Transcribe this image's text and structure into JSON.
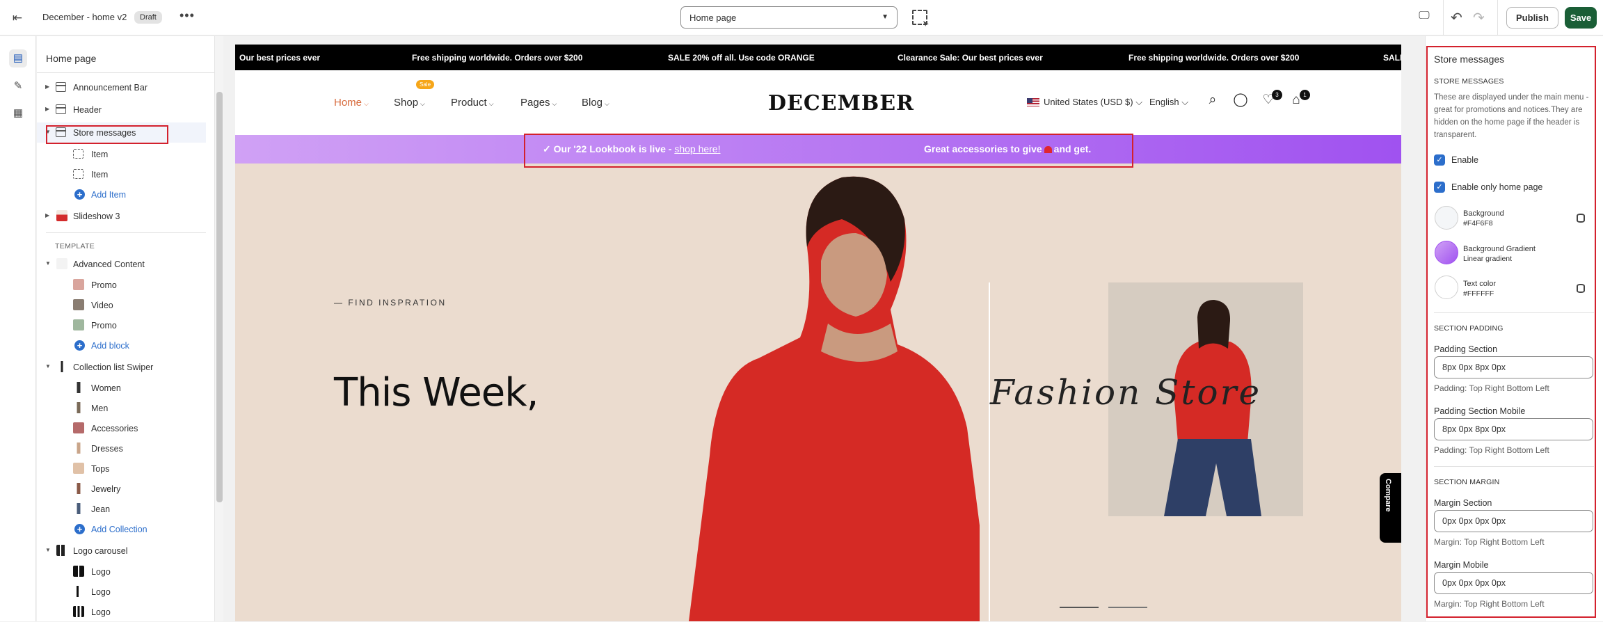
{
  "topbar": {
    "title": "December - home v2",
    "draft": "Draft",
    "page_select": "Home page",
    "publish": "Publish",
    "save": "Save"
  },
  "sidebar": {
    "title": "Home page",
    "header_sections": [
      {
        "label": "Announcement Bar"
      },
      {
        "label": "Header"
      },
      {
        "label": "Store messages"
      },
      {
        "label": "Item"
      },
      {
        "label": "Item"
      },
      {
        "label": "Add Item"
      },
      {
        "label": "Slideshow 3"
      }
    ],
    "template_label": "TEMPLATE",
    "advanced_content": {
      "label": "Advanced Content",
      "blocks": [
        "Promo",
        "Video",
        "Promo"
      ],
      "add": "Add block"
    },
    "collection_list": {
      "label": "Collection list Swiper",
      "blocks": [
        "Women",
        "Men",
        "Accessories",
        "Dresses",
        "Tops",
        "Jewelry",
        "Jean"
      ],
      "add": "Add Collection"
    },
    "logo_carousel": {
      "label": "Logo carousel",
      "blocks": [
        "Logo",
        "Logo",
        "Logo"
      ]
    }
  },
  "preview": {
    "announcements": [
      "Our best prices ever",
      "Free shipping worldwide. Orders over $200",
      "SALE 20% off all. Use code ORANGE",
      "Clearance Sale: Our best prices ever",
      "Free shipping worldwide. Orders over $200",
      "SALE"
    ],
    "nav": [
      "Home",
      "Shop",
      "Product",
      "Pages",
      "Blog"
    ],
    "sale_tag": "Sale",
    "logo": "DECEMBER",
    "currency": "United States (USD $)",
    "language": "English",
    "wishlist_count": "3",
    "cart_count": "1",
    "store_messages": {
      "msg1_prefix": "Our '22 Lookbook is live - ",
      "msg1_link": "shop here!",
      "msg2_prefix": "Great accessories to give",
      "msg2_suffix": "and get."
    },
    "hero": {
      "eyebrow": "— FIND INSPRATION",
      "headline": "This Week,",
      "script": "Fashion Store"
    },
    "compare": "Compare"
  },
  "settings": {
    "title": "Store messages",
    "heading": "STORE MESSAGES",
    "description": "These are displayed under the main menu - great for promotions and notices.They are hidden on the home page if the header is transparent.",
    "enable": "Enable",
    "enable_home": "Enable only home page",
    "background": {
      "label": "Background",
      "value": "#F4F6F8"
    },
    "gradient": {
      "label": "Background Gradient",
      "value": "Linear gradient"
    },
    "text_color": {
      "label": "Text color",
      "value": "#FFFFFF"
    },
    "padding_heading": "SECTION PADDING",
    "padding_section": {
      "label": "Padding Section",
      "value": "8px 0px 8px 0px",
      "help": "Padding: Top Right Bottom Left"
    },
    "padding_mobile": {
      "label": "Padding Section Mobile",
      "value": "8px 0px 8px 0px",
      "help": "Padding: Top Right Bottom Left"
    },
    "margin_heading": "SECTION MARGIN",
    "margin_section": {
      "label": "Margin Section",
      "value": "0px 0px 0px 0px",
      "help": "Margin: Top Right Bottom Left"
    },
    "margin_mobile": {
      "label": "Margin Mobile",
      "value": "0px 0px 0px 0px",
      "help": "Margin: Top Right Bottom Left"
    }
  },
  "colors": {
    "accent": "#d3212d",
    "save": "#1a5e36",
    "link": "#2c6ecb",
    "store_msg_from": "#d0a1f5",
    "store_msg_to": "#a052f0"
  }
}
